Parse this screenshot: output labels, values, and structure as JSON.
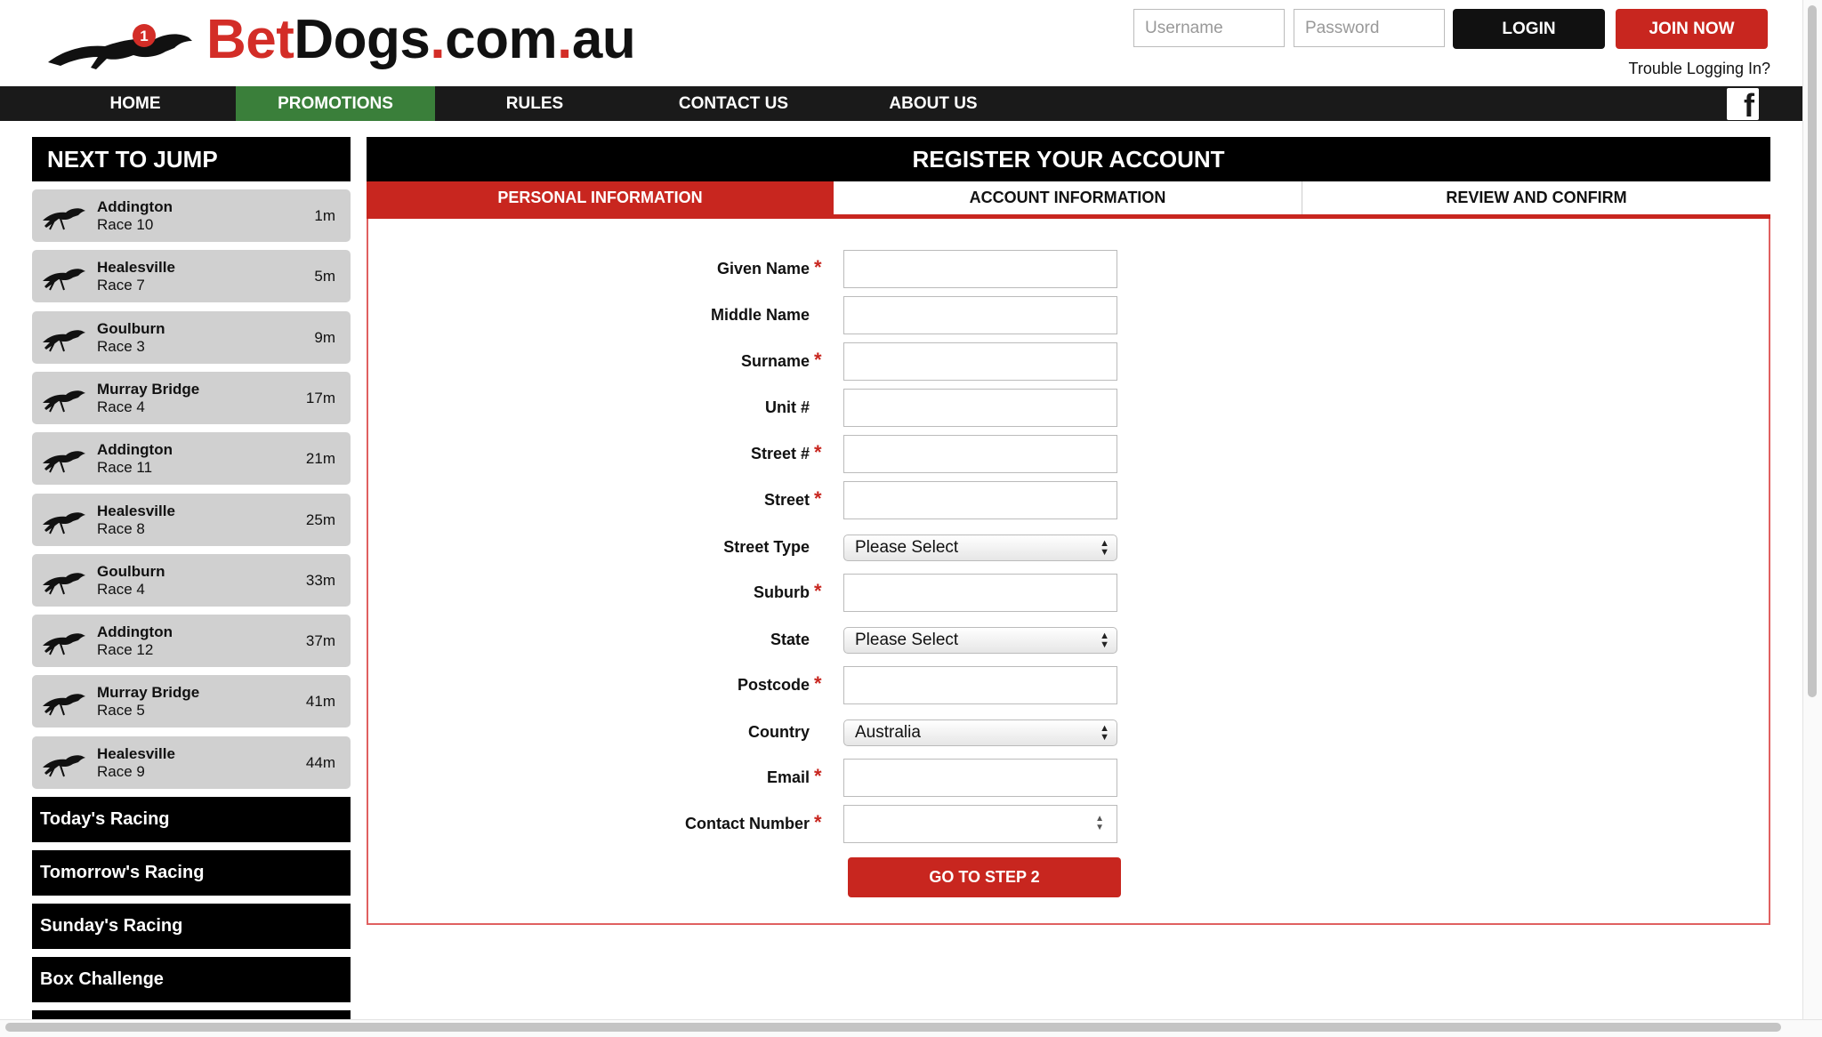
{
  "header": {
    "logo": {
      "part1": "Bet",
      "part2": "Dogs",
      "part3": ".",
      "part4": "com",
      "part5": ".",
      "part6": "au",
      "badge": "1"
    },
    "username_placeholder": "Username",
    "password_placeholder": "Password",
    "login_label": "LOGIN",
    "join_label": "JOIN NOW",
    "trouble_label": "Trouble Logging In?"
  },
  "nav": {
    "items": [
      {
        "label": "HOME"
      },
      {
        "label": "PROMOTIONS",
        "active": true
      },
      {
        "label": "RULES"
      },
      {
        "label": "CONTACT US"
      },
      {
        "label": "ABOUT US"
      }
    ],
    "facebook_icon": "facebook-icon"
  },
  "sidebar": {
    "title": "NEXT TO JUMP",
    "races": [
      {
        "venue": "Addington",
        "race": "Race 10",
        "time": "1m"
      },
      {
        "venue": "Healesville",
        "race": "Race 7",
        "time": "5m"
      },
      {
        "venue": "Goulburn",
        "race": "Race 3",
        "time": "9m"
      },
      {
        "venue": "Murray Bridge",
        "race": "Race 4",
        "time": "17m"
      },
      {
        "venue": "Addington",
        "race": "Race 11",
        "time": "21m"
      },
      {
        "venue": "Healesville",
        "race": "Race 8",
        "time": "25m"
      },
      {
        "venue": "Goulburn",
        "race": "Race 4",
        "time": "33m"
      },
      {
        "venue": "Addington",
        "race": "Race 12",
        "time": "37m"
      },
      {
        "venue": "Murray Bridge",
        "race": "Race 5",
        "time": "41m"
      },
      {
        "venue": "Healesville",
        "race": "Race 9",
        "time": "44m"
      }
    ],
    "links": [
      "Today's Racing",
      "Tomorrow's Racing",
      "Sunday's Racing",
      "Box Challenge"
    ]
  },
  "register": {
    "title": "REGISTER YOUR ACCOUNT",
    "tabs": [
      "PERSONAL INFORMATION",
      "ACCOUNT INFORMATION",
      "REVIEW AND CONFIRM"
    ],
    "fields": {
      "given_name": {
        "label": "Given Name",
        "required": "*",
        "value": ""
      },
      "middle_name": {
        "label": "Middle Name",
        "value": ""
      },
      "surname": {
        "label": "Surname",
        "required": "*",
        "value": ""
      },
      "unit": {
        "label": "Unit #",
        "value": ""
      },
      "street_no": {
        "label": "Street #",
        "required": "*",
        "value": ""
      },
      "street": {
        "label": "Street",
        "required": "*",
        "value": ""
      },
      "street_type": {
        "label": "Street Type",
        "selected": "Please Select"
      },
      "suburb": {
        "label": "Suburb",
        "required": "*",
        "value": ""
      },
      "state": {
        "label": "State",
        "selected": "Please Select"
      },
      "postcode": {
        "label": "Postcode",
        "required": "*",
        "value": ""
      },
      "country": {
        "label": "Country",
        "selected": "Australia"
      },
      "email": {
        "label": "Email",
        "required": "*",
        "value": ""
      },
      "contact": {
        "label": "Contact Number",
        "required": "*",
        "value": ""
      }
    },
    "submit_label": "GO TO STEP 2"
  },
  "colors": {
    "brand_red": "#c8261f",
    "nav_bg": "#1a1a1a",
    "active_green": "#3a7f3a"
  }
}
